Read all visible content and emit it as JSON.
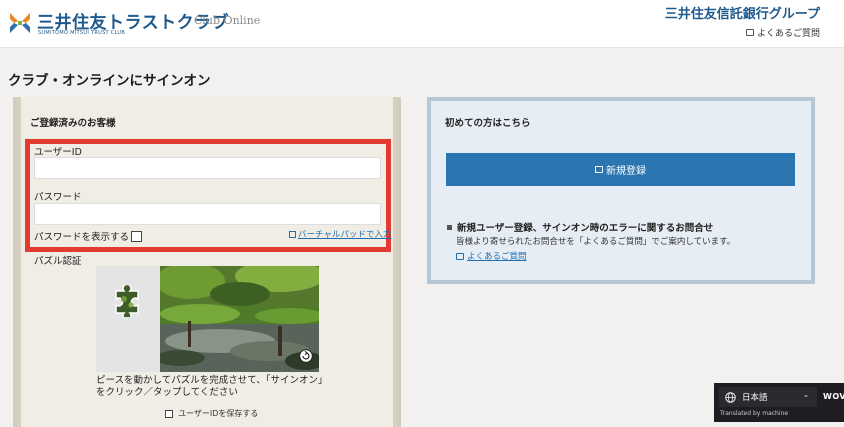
{
  "header": {
    "brand_name": "三井住友トラストクラブ",
    "brand_sub": "SUMITOMO MITSUI TRUST CLUB",
    "club_online": "Club Online",
    "group_name": "三井住友信託銀行グループ",
    "faq_label": "よくあるご質問"
  },
  "page": {
    "title": "クラブ・オンラインにサインオン"
  },
  "login_panel": {
    "title": "ご登録済みのお客様",
    "user_id_label": "ユーザーID",
    "user_id_value": "",
    "password_label": "パスワード",
    "password_value": "",
    "show_password_label": "パスワードを表示する",
    "virtual_keypad_label": "バーチャルパッドで入力",
    "puzzle_label": "パズル認証",
    "puzzle_instruction": "ピースを動かしてパズルを完成させて、「サインオン」をクリック／タップしてください",
    "save_id_label": "ユーザーIDを保存する"
  },
  "register_panel": {
    "title": "初めての方はこちら",
    "register_button": "新規登録",
    "inquiry_title": "新規ユーザー登録、サインオン時のエラーに関するお問合せ",
    "inquiry_desc": "皆様より寄せられたお問合せを「よくあるご質問」でご案内しています。",
    "faq_link": "よくあるご質問"
  },
  "translate_widget": {
    "language": "日本語",
    "brand": "WOVN",
    "translated_by": "Translated by machine"
  },
  "colors": {
    "brand_blue": "#1f5a8c",
    "highlight_red": "#e33a31",
    "button_blue": "#2b76b0",
    "link_blue": "#1f6fb2"
  }
}
